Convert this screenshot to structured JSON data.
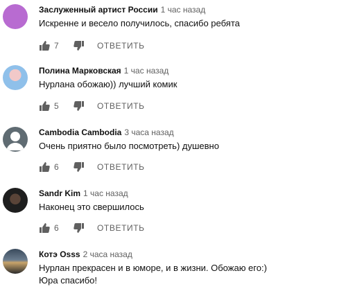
{
  "reply_label": "ОТВЕТИТЬ",
  "comments": [
    {
      "author": "Заслуженный артист России",
      "time": "1 час назад",
      "text": "Искренне и весело получилось, спасибо ребята",
      "likes": "7",
      "avatar_color": "#b86bd1"
    },
    {
      "author": "Полина Марковская",
      "time": "1 час назад",
      "text": "Нурлана обожаю)) лучший комик",
      "likes": "5",
      "avatar_color": "#7fb0e0"
    },
    {
      "author": "Cambodia Cambodia",
      "time": "3 часа назад",
      "text": "Очень приятно было посмотреть)  душевно",
      "likes": "6",
      "avatar_color": "#5f6b72"
    },
    {
      "author": "Sandr Kim",
      "time": "1 час назад",
      "text": "Наконец это свершилось",
      "likes": "6",
      "avatar_color": "#2a2a2a"
    },
    {
      "author": "Котэ Osss",
      "time": "2 часа назад",
      "text_lines": [
        "Нурлан прекрасен и в юморе, и в жизни. Обожаю его:)",
        "Юра спасибо!"
      ],
      "avatar_color": "#3a4a5c"
    }
  ],
  "colors": {
    "text": "#0f0f0f",
    "secondary": "#606060"
  }
}
